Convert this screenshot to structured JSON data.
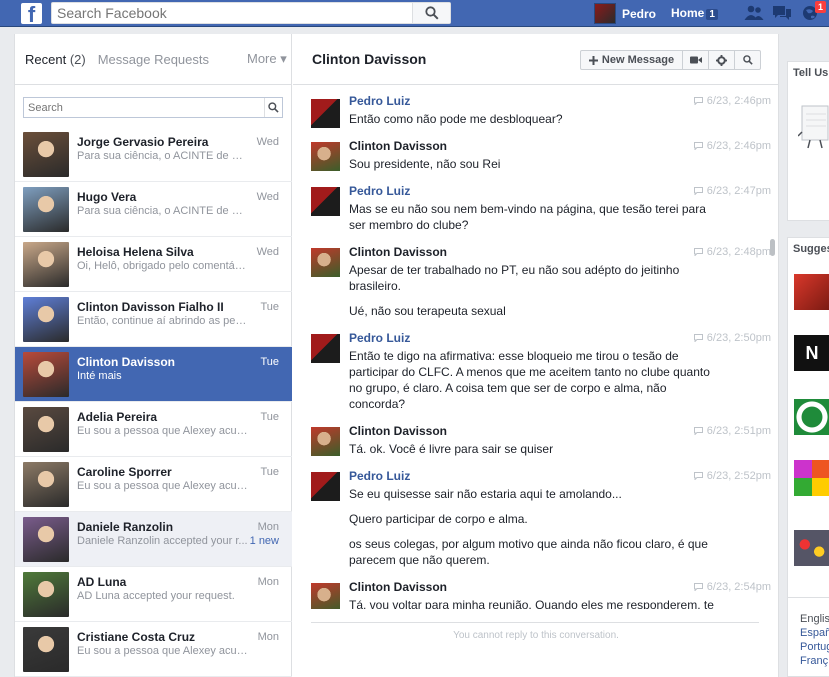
{
  "topbar": {
    "logo": "f",
    "search_placeholder": "Search Facebook",
    "user_name": "Pedro",
    "home_label": "Home",
    "home_count": "1",
    "notification_count": "1"
  },
  "inbox": {
    "tab_recent": "Recent",
    "recent_count": "(2)",
    "tab_requests": "Message Requests",
    "tab_more": "More ▾",
    "search_placeholder": "Search",
    "threads": [
      {
        "name": "Jorge Gervasio Pereira",
        "snippet": "Para sua ciência, o ACINTE de Cl...",
        "time": "Wed",
        "avatar_color": "#6b4f3a"
      },
      {
        "name": "Hugo Vera",
        "snippet": "Para sua ciência, o ACINTE de Cl...",
        "time": "Wed",
        "avatar_color": "#7f9fc0"
      },
      {
        "name": "Heloisa Helena Silva",
        "snippet": "Oi, Helô, obrigado pelo comentári...",
        "time": "Wed",
        "avatar_color": "#c9a889"
      },
      {
        "name": "Clinton Davisson Fialho II",
        "snippet": "Então, continue aí abrindo as pern...",
        "time": "Tue",
        "avatar_color": "#5f7fd8"
      },
      {
        "name": "Clinton Davisson",
        "snippet": "Inté mais",
        "time": "Tue",
        "avatar_color": "#b94a3a"
      },
      {
        "name": "Adelia Pereira",
        "snippet": "Eu sou a pessoa que Alexey acus...",
        "time": "Tue",
        "avatar_color": "#5a4a40"
      },
      {
        "name": "Caroline Sporrer",
        "snippet": "Eu sou a pessoa que Alexey acus...",
        "time": "Tue",
        "avatar_color": "#8c7a66"
      },
      {
        "name": "Daniele Ranzolin",
        "snippet": "Daniele Ranzolin accepted your r...",
        "time": "Mon",
        "new_label": "1 new",
        "avatar_color": "#7a5c8c"
      },
      {
        "name": "AD Luna",
        "snippet": "AD Luna accepted your request.",
        "time": "Mon",
        "avatar_color": "#4f7a3a"
      },
      {
        "name": "Cristiane Costa Cruz",
        "snippet": "Eu sou a pessoa que Alexey acus...",
        "time": "Mon",
        "avatar_color": "#3a3a3a"
      }
    ]
  },
  "conversation": {
    "title": "Clinton Davisson",
    "new_message_label": "New Message",
    "footer_note": "You cannot reply to this conversation.",
    "messages": [
      {
        "sender": "Pedro Luiz",
        "time": "6/23, 2:46pm",
        "lines": [
          "Então como não pode me desbloquear?"
        ]
      },
      {
        "sender": "Clinton Davisson",
        "time": "6/23, 2:46pm",
        "lines": [
          "Sou presidente, não sou Rei"
        ]
      },
      {
        "sender": "Pedro Luiz",
        "time": "6/23, 2:47pm",
        "lines": [
          "Mas se eu não sou nem bem-vindo na página, que tesão terei para",
          "ser membro do clube?"
        ]
      },
      {
        "sender": "Clinton Davisson",
        "time": "6/23, 2:48pm",
        "lines": [
          "Apesar de ter trabalhado no PT, eu não sou adépto do jeitinho",
          "brasileiro."
        ],
        "extra": [
          "Ué, não sou terapeuta sexual"
        ]
      },
      {
        "sender": "Pedro Luiz",
        "time": "6/23, 2:50pm",
        "lines": [
          "Então te digo na afirmativa: esse bloqueio me tirou o tesão de",
          "participar do CLFC. A menos que me aceitem tanto no clube quanto",
          "no grupo, é claro. A coisa tem que ser de corpo e alma, não",
          "concorda?"
        ]
      },
      {
        "sender": "Clinton Davisson",
        "time": "6/23, 2:51pm",
        "lines": [
          "Tá. ok. Você é livre para sair se quiser"
        ]
      },
      {
        "sender": "Pedro Luiz",
        "time": "6/23, 2:52pm",
        "lines": [
          "Se eu quisesse sair não estaria aqui te amolando..."
        ],
        "extra": [
          "Quero participar de corpo e alma."
        ],
        "extra2": [
          "os seus colegas, por algum motivo que ainda não ficou claro, é que",
          "parecem que não querem."
        ]
      },
      {
        "sender": "Clinton Davisson",
        "time": "6/23, 2:54pm",
        "lines": [
          "Tá, vou voltar para minha reunião. Quando eles me responderem, te"
        ]
      }
    ]
  },
  "right_sidebar": {
    "tell_us": "Tell Us",
    "suggested": "Sugges",
    "languages": [
      "English",
      "Españ",
      "Portug",
      "Franç"
    ]
  }
}
